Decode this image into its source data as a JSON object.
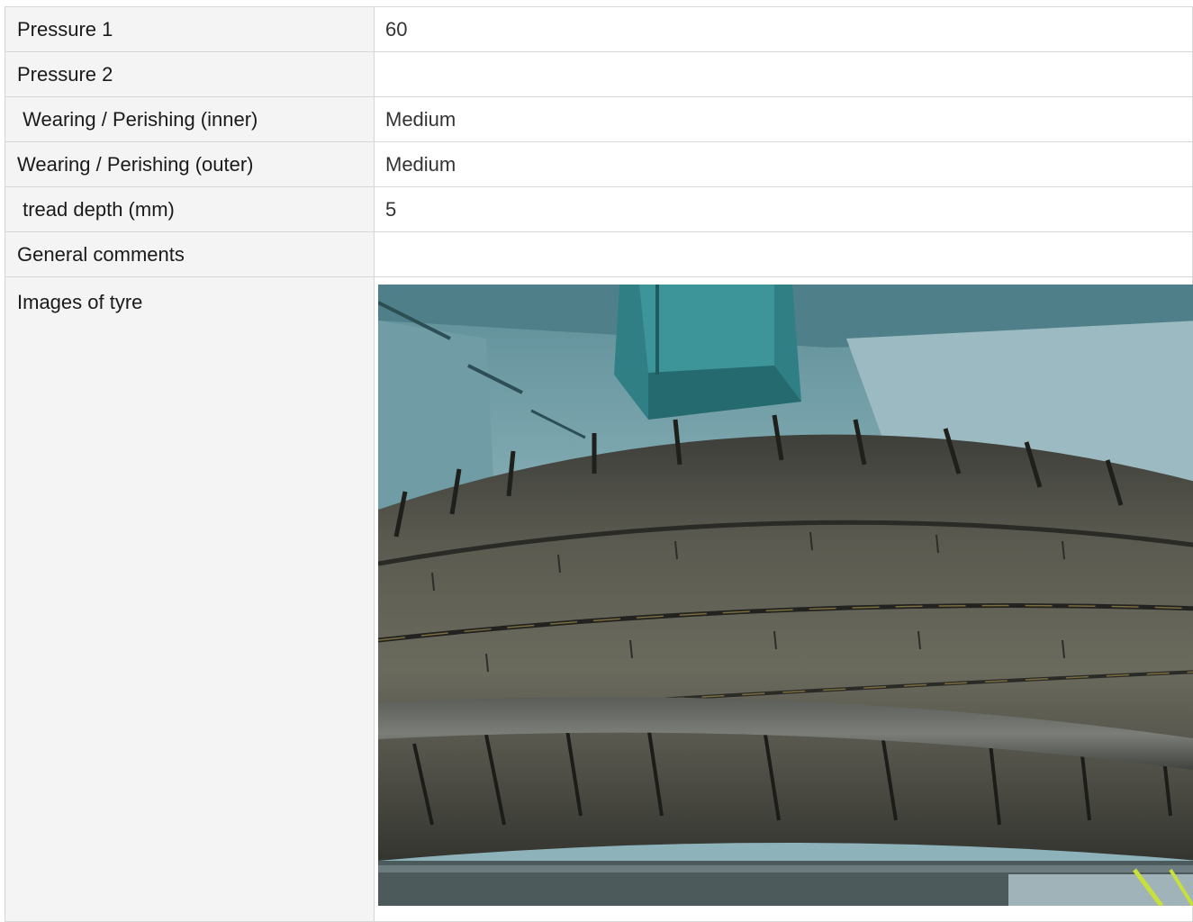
{
  "rows": [
    {
      "label": "Pressure 1",
      "value": "60"
    },
    {
      "label": "Pressure 2",
      "value": ""
    },
    {
      "label": " Wearing / Perishing (inner)",
      "value": "Medium"
    },
    {
      "label": "Wearing / Perishing (outer)",
      "value": "Medium"
    },
    {
      "label": " tread depth (mm)",
      "value": "5"
    },
    {
      "label": "General comments",
      "value": ""
    }
  ],
  "images": {
    "label": "Images of tyre",
    "photo_subject": "tyre-tread-photo"
  },
  "colors": {
    "label_bg": "#f4f4f4",
    "border": "#d6d6d6",
    "chassis_teal": "#2f7f84",
    "tyre_rubber": "#4a4a44"
  }
}
